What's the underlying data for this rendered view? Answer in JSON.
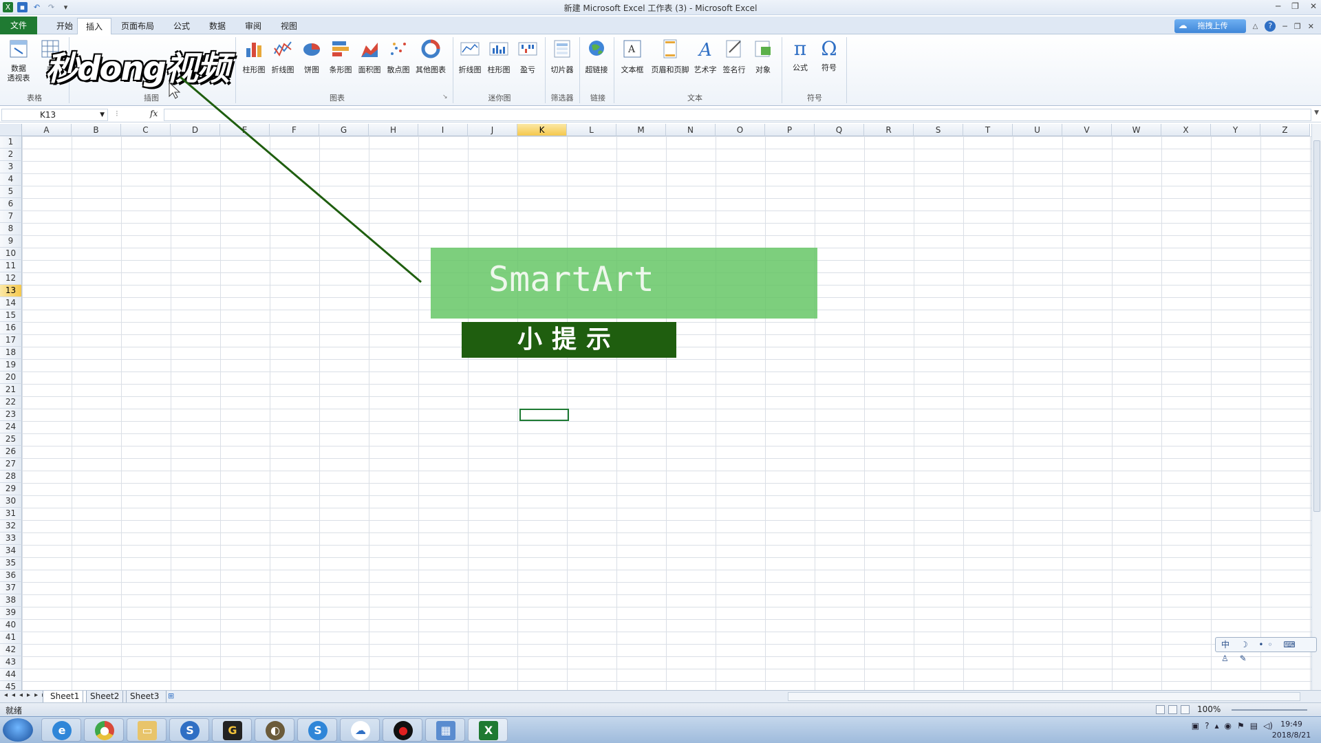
{
  "window": {
    "title": "新建 Microsoft Excel 工作表 (3) - Microsoft Excel",
    "controls": [
      "─",
      "❐",
      "✕"
    ]
  },
  "tabs": {
    "file": "文件",
    "items": [
      "开始",
      "插入",
      "页面布局",
      "公式",
      "数据",
      "审阅",
      "视图"
    ],
    "active": "插入",
    "upload": "拖拽上传"
  },
  "ribbon": {
    "buttons": {
      "pivot": "数据\n透视表",
      "table": "表",
      "col_chart": "柱形图",
      "line_chart": "折线图",
      "pie_chart": "饼图",
      "bar_chart": "条形图",
      "area_chart": "面积图",
      "scatter_chart": "散点图",
      "other_chart": "其他图表",
      "spark_line": "折线图",
      "spark_col": "柱形图",
      "spark_winloss": "盈亏",
      "slicer": "切片器",
      "hyperlink": "超链接",
      "textbox": "文本框",
      "header_footer": "页眉和页脚",
      "wordart": "艺术字",
      "signature": "签名行",
      "object": "对象",
      "equation": "公式",
      "symbol": "符号"
    },
    "groups": {
      "tables": "表格",
      "illustrations": "插图",
      "charts": "图表",
      "sparklines": "迷你图",
      "filter": "筛选器",
      "links": "链接",
      "text": "文本",
      "symbols": "符号"
    }
  },
  "formula_bar": {
    "name_box": "K13",
    "fx": "fx",
    "value": ""
  },
  "grid": {
    "columns": [
      "A",
      "B",
      "C",
      "D",
      "E",
      "F",
      "G",
      "H",
      "I",
      "J",
      "K",
      "L",
      "M",
      "N",
      "O",
      "P",
      "Q",
      "R",
      "S",
      "T",
      "U",
      "V",
      "W",
      "X",
      "Y",
      "Z"
    ],
    "rows": [
      "1",
      "2",
      "3",
      "4",
      "5",
      "6",
      "7",
      "8",
      "9",
      "10",
      "11",
      "12",
      "13",
      "14",
      "15",
      "16",
      "17",
      "18",
      "19",
      "20",
      "21",
      "22",
      "23",
      "24",
      "25",
      "26",
      "27",
      "28",
      "29",
      "30",
      "31",
      "32",
      "33",
      "34",
      "35",
      "36",
      "37",
      "38",
      "39",
      "40",
      "41",
      "42",
      "43",
      "44",
      "45"
    ],
    "selected_col": "K",
    "selected_row": "13"
  },
  "overlay": {
    "watermark": "秒dong视频",
    "smartart_label": "SmartArt",
    "tip_label": "小提示"
  },
  "sheets": [
    "Sheet1",
    "Sheet2",
    "Sheet3"
  ],
  "status": {
    "ready": "就绪",
    "zoom": "100%"
  },
  "ime": "中",
  "clock": {
    "time": "19:49",
    "date": "2018/8/21"
  }
}
